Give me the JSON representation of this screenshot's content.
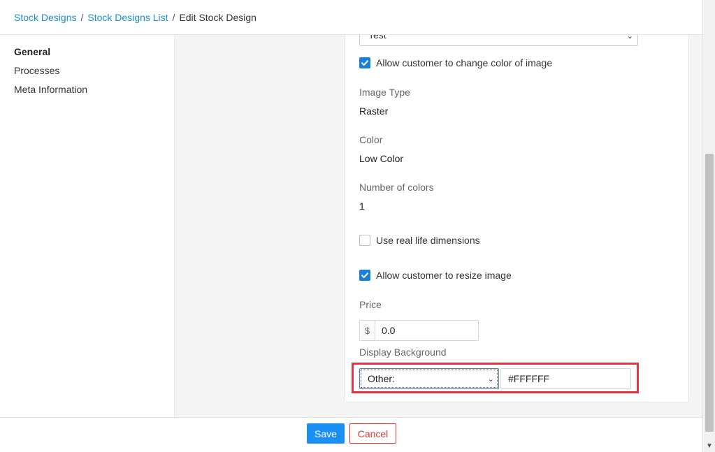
{
  "breadcrumb": {
    "item1": "Stock Designs",
    "sep1": "/",
    "item2": "Stock Designs List",
    "sep2": "/",
    "current": "Edit Stock Design"
  },
  "sidebar": {
    "items": [
      {
        "label": "General",
        "active": true
      },
      {
        "label": "Processes",
        "active": false
      },
      {
        "label": "Meta Information",
        "active": false
      }
    ]
  },
  "form": {
    "top_select_value": "Test",
    "allow_change_color": {
      "label": "Allow customer to change color of image",
      "checked": true
    },
    "image_type": {
      "label": "Image Type",
      "value": "Raster"
    },
    "color": {
      "label": "Color",
      "value": "Low Color"
    },
    "number_of_colors": {
      "label": "Number of colors",
      "value": "1"
    },
    "use_real_dimensions": {
      "label": "Use real life dimensions",
      "checked": false
    },
    "allow_resize": {
      "label": "Allow customer to resize image",
      "checked": true
    },
    "price": {
      "label": "Price",
      "currency": "$",
      "value": "0.0"
    },
    "display_background": {
      "label": "Display Background",
      "select_value": "Other:",
      "color_value": "#FFFFFF"
    }
  },
  "footer": {
    "save_label": "Save",
    "cancel_label": "Cancel"
  },
  "colors": {
    "link": "#1a8fd6",
    "primary": "#1a90f5",
    "danger": "#d23b30",
    "highlight": "#e5343d"
  },
  "icons": {
    "checkbox_checked": "checkmark-icon",
    "select_chevron": "chevron-down-icon"
  }
}
